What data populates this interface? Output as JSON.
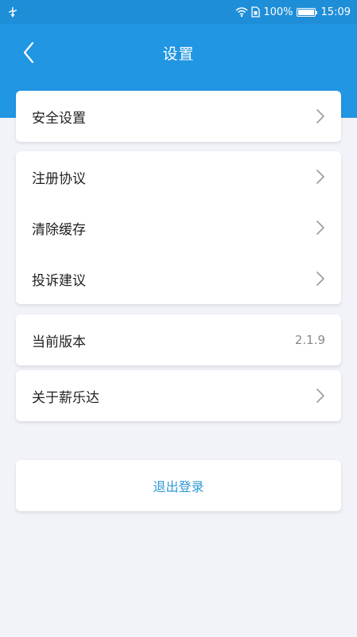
{
  "status_bar": {
    "usb_icon": "usb-icon",
    "battery_percent": "100%",
    "time": "15:09"
  },
  "header": {
    "title": "设置",
    "back_icon": "chevron-left-icon",
    "background_color": "#2196e3"
  },
  "groups": {
    "security": {
      "label": "安全设置"
    },
    "legal": {
      "items": [
        {
          "label": "注册协议"
        },
        {
          "label": "清除缓存"
        },
        {
          "label": "投诉建议"
        }
      ]
    },
    "version": {
      "label": "当前版本",
      "value": "2.1.9"
    },
    "about": {
      "label": "关于薪乐达"
    }
  },
  "logout": {
    "label": "退出登录",
    "color": "#2e9ad6"
  },
  "icons": {
    "row_chevron": "chevron-right-icon"
  }
}
